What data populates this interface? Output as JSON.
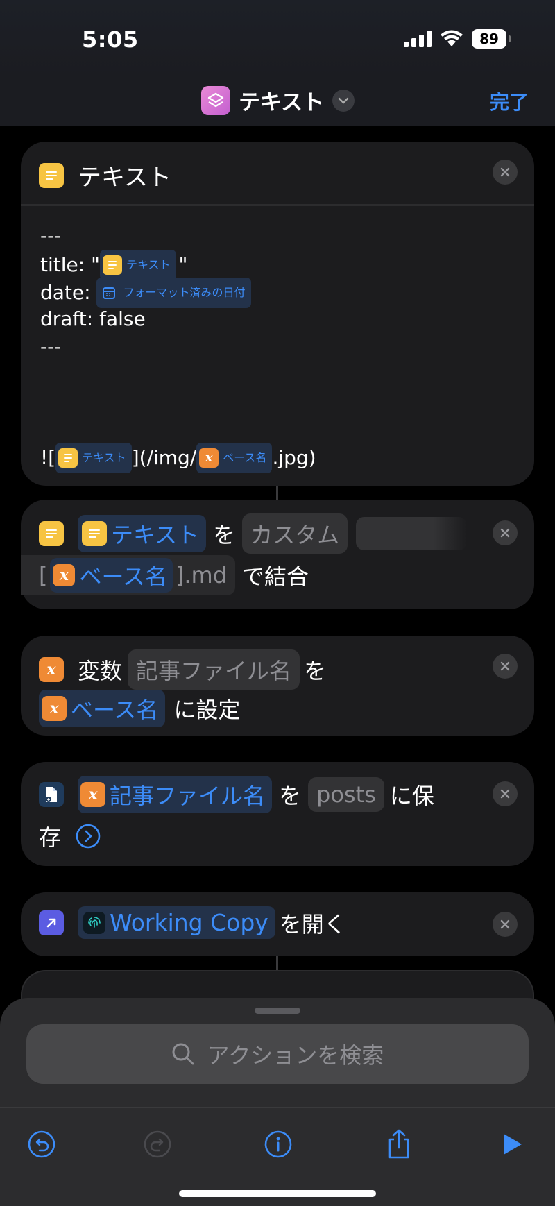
{
  "status": {
    "time": "5:05",
    "battery": "89"
  },
  "nav": {
    "title": "テキスト",
    "done_label": "完了"
  },
  "text_action": {
    "title": "テキスト",
    "line1": "---",
    "line2_prefix": "title: \"",
    "line2_token": "テキスト",
    "line2_suffix": "\"",
    "line3_prefix": "date: ",
    "line3_token": "フォーマット済みの日付",
    "line4": "draft: false",
    "line5": "---",
    "line6_prefix": "![",
    "line6_token1": "テキスト",
    "line6_mid": "](/img/",
    "line6_token2": "ベース名",
    "line6_suffix": ".jpg)"
  },
  "combine_action": {
    "token": "テキスト",
    "wo": "を",
    "param": "カスタム",
    "custom_prefix": "[",
    "custom_token": "ベース名",
    "custom_suffix": "].md",
    "tail": "で結合"
  },
  "setvar_action": {
    "label": "変数",
    "var_name": "記事ファイル名",
    "wo": "を",
    "token": "ベース名",
    "tail": "に設定"
  },
  "save_action": {
    "token": "記事ファイル名",
    "wo": "を",
    "folder": "posts",
    "tail1": "に保",
    "tail2": "存"
  },
  "open_action": {
    "app": "Working Copy",
    "tail": "を開く"
  },
  "search": {
    "placeholder": "アクションを検索"
  },
  "colors": {
    "accent": "#3c8cf8",
    "card": "#1c1c1e",
    "variable": "#ef8a35",
    "text_icon": "#f7c443"
  }
}
